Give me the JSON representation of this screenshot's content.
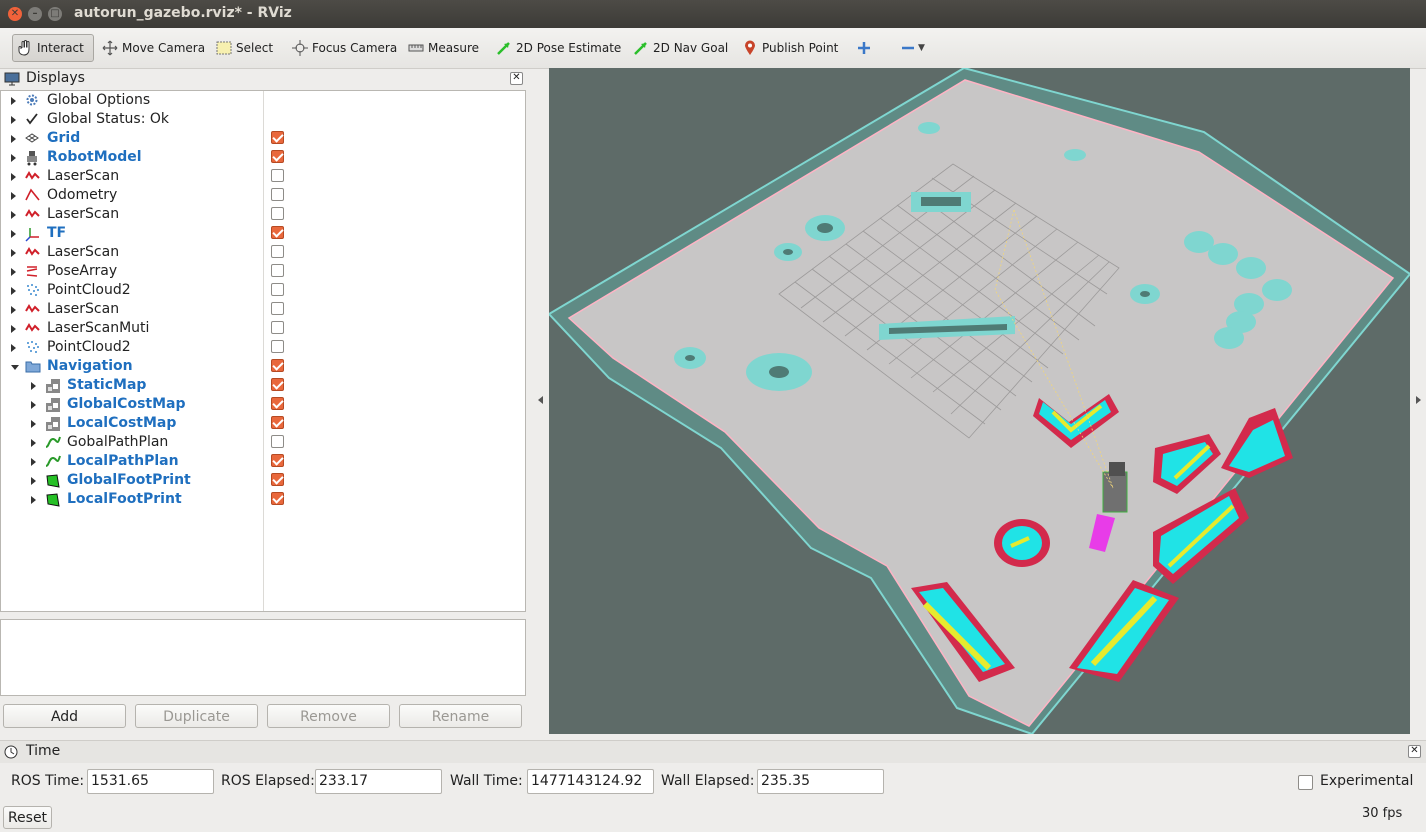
{
  "window": {
    "title": "autorun_gazebo.rviz* - RViz"
  },
  "toolbar": {
    "tools": [
      {
        "label": "Interact",
        "icon": "hand-cursor-icon",
        "active": true
      },
      {
        "label": "Move Camera",
        "icon": "move-camera-icon"
      },
      {
        "label": "Select",
        "icon": "select-box-icon"
      },
      {
        "label": "Focus Camera",
        "icon": "focus-camera-icon"
      },
      {
        "label": "Measure",
        "icon": "ruler-icon"
      },
      {
        "label": "2D Pose Estimate",
        "icon": "green-arrow-icon"
      },
      {
        "label": "2D Nav Goal",
        "icon": "green-arrow-icon"
      },
      {
        "label": "Publish Point",
        "icon": "map-pin-icon"
      }
    ],
    "extra_icons": [
      "plus-icon",
      "minus-icon",
      "dropdown-icon"
    ],
    "accent": "#3b78c8"
  },
  "displays": {
    "title": "Displays",
    "items": [
      {
        "label": "Global Options",
        "icon": "gear-icon",
        "checkbox": null,
        "bold": false,
        "indent": 0
      },
      {
        "label": "Global Status: Ok",
        "icon": "checkmark-icon",
        "checkbox": null,
        "bold": false,
        "indent": 0
      },
      {
        "label": "Grid",
        "icon": "grid-icon",
        "checkbox": true,
        "bold": true,
        "indent": 0
      },
      {
        "label": "RobotModel",
        "icon": "robot-icon",
        "checkbox": true,
        "bold": true,
        "indent": 0
      },
      {
        "label": "LaserScan",
        "icon": "laserscan-icon",
        "checkbox": false,
        "bold": false,
        "indent": 0
      },
      {
        "label": "Odometry",
        "icon": "odometry-icon",
        "checkbox": false,
        "bold": false,
        "indent": 0
      },
      {
        "label": "LaserScan",
        "icon": "laserscan-icon",
        "checkbox": false,
        "bold": false,
        "indent": 0
      },
      {
        "label": "TF",
        "icon": "tf-axes-icon",
        "checkbox": true,
        "bold": true,
        "indent": 0
      },
      {
        "label": "LaserScan",
        "icon": "laserscan-icon",
        "checkbox": false,
        "bold": false,
        "indent": 0
      },
      {
        "label": "PoseArray",
        "icon": "pose-array-icon",
        "checkbox": false,
        "bold": false,
        "indent": 0
      },
      {
        "label": "PointCloud2",
        "icon": "pointcloud-icon",
        "checkbox": false,
        "bold": false,
        "indent": 0
      },
      {
        "label": "LaserScan",
        "icon": "laserscan-icon",
        "checkbox": false,
        "bold": false,
        "indent": 0
      },
      {
        "label": "LaserScanMuti",
        "icon": "laserscan-icon",
        "checkbox": false,
        "bold": false,
        "indent": 0
      },
      {
        "label": "PointCloud2",
        "icon": "pointcloud-icon",
        "checkbox": false,
        "bold": false,
        "indent": 0
      },
      {
        "label": "Navigation",
        "icon": "folder-icon",
        "checkbox": true,
        "bold": true,
        "indent": 0,
        "expanded": true
      },
      {
        "label": "StaticMap",
        "icon": "map-icon",
        "checkbox": true,
        "bold": true,
        "indent": 1
      },
      {
        "label": "GlobalCostMap",
        "icon": "map-icon",
        "checkbox": true,
        "bold": true,
        "indent": 1
      },
      {
        "label": "LocalCostMap",
        "icon": "map-icon",
        "checkbox": true,
        "bold": true,
        "indent": 1
      },
      {
        "label": "GobalPathPlan",
        "icon": "path-icon",
        "checkbox": false,
        "bold": false,
        "indent": 1
      },
      {
        "label": "LocalPathPlan",
        "icon": "path-icon",
        "checkbox": true,
        "bold": true,
        "indent": 1
      },
      {
        "label": "GlobalFootPrint",
        "icon": "polygon-icon",
        "checkbox": true,
        "bold": true,
        "indent": 1
      },
      {
        "label": "LocalFootPrint",
        "icon": "polygon-icon",
        "checkbox": true,
        "bold": true,
        "indent": 1
      }
    ],
    "buttons": {
      "add": "Add",
      "duplicate": "Duplicate",
      "remove": "Remove",
      "rename": "Rename"
    },
    "check_color": "#e9683c"
  },
  "time": {
    "title": "Time",
    "ros_time_label": "ROS Time:",
    "ros_time": "1531.65",
    "ros_elapsed_label": "ROS Elapsed:",
    "ros_elapsed": "233.17",
    "wall_time_label": "Wall Time:",
    "wall_time": "1477143124.92",
    "wall_elapsed_label": "Wall Elapsed:",
    "wall_elapsed": "235.35",
    "experimental_label": "Experimental",
    "reset_label": "Reset",
    "fps": "30 fps"
  },
  "view3d": {
    "background": "#5e6b68",
    "floor_color": "#c9c7c7",
    "inflation_color": "#7fd6d0",
    "cost_lethal": "#d32a4c",
    "cost_mid": "#20e3e6",
    "cost_core": "#e6ea2e",
    "footprint_color": "#e83ce8"
  }
}
